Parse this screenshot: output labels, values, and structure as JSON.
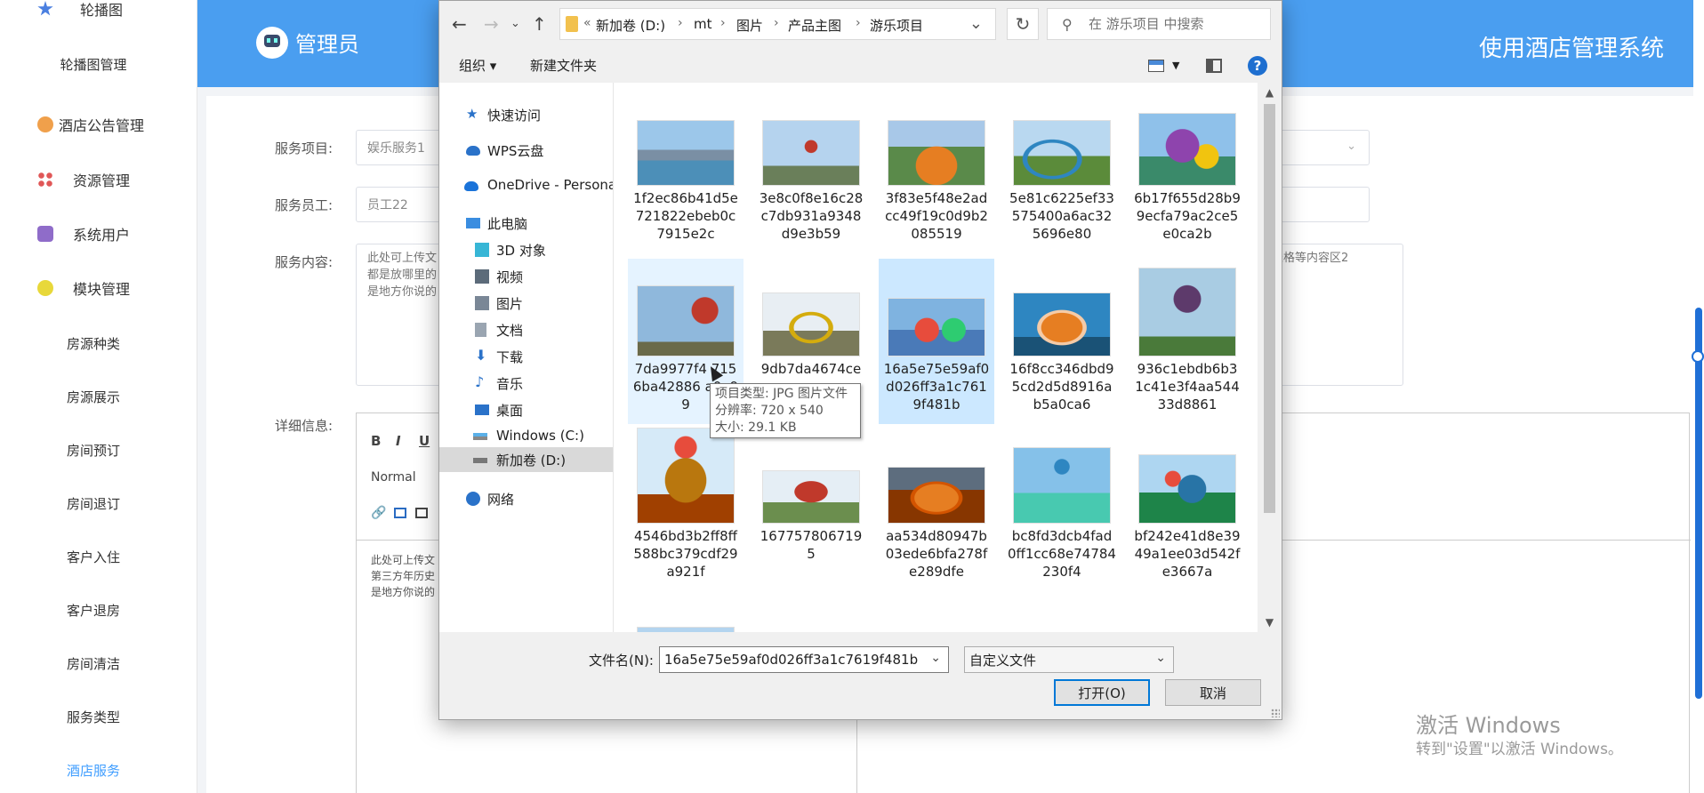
{
  "sidebar": {
    "items": [
      {
        "label": "轮播图",
        "icon": "star-icon"
      },
      {
        "label": "轮播图管理"
      },
      {
        "label": "酒店公告管理",
        "icon": "gear-icon"
      },
      {
        "label": "资源管理",
        "icon": "grid-icon"
      },
      {
        "label": "系统用户",
        "icon": "box-icon"
      },
      {
        "label": "模块管理",
        "icon": "cube-icon"
      },
      {
        "label": "房源种类"
      },
      {
        "label": "房源展示"
      },
      {
        "label": "房间预订"
      },
      {
        "label": "房间退订"
      },
      {
        "label": "客户入住"
      },
      {
        "label": "客户退房"
      },
      {
        "label": "房间清洁"
      },
      {
        "label": "服务类型"
      },
      {
        "label": "酒店服务"
      }
    ],
    "active_index": 14
  },
  "header": {
    "brand": "管理员",
    "system_title": "使用酒店管理系统"
  },
  "form": {
    "service_item_label": "服务项目:",
    "service_item_value": "娱乐服务1",
    "staff_label": "服务员工:",
    "staff_value": "员工22",
    "content_label": "服务内容:",
    "content_text_left": "此处可上传文\n都是放哪里的\n是地方你说的",
    "content_text_right": "、表格等内容区2",
    "detail_label": "详细信息:",
    "editor_bold": "B",
    "editor_italic": "I",
    "editor_underline": "U",
    "editor_format": "Normal",
    "editor_text": "此处可上传文\n第三方年历史\n是地方你说的"
  },
  "watermark": {
    "line1": "激活 Windows",
    "line2": "转到\"设置\"以激活 Windows。"
  },
  "dialog": {
    "address": [
      "新加卷 (D:)",
      "mt",
      "图片",
      "产品主图",
      "游乐项目"
    ],
    "address_prefix": "«",
    "search_placeholder": "在 游乐项目 中搜索",
    "organize": "组织 ▾",
    "new_folder": "新建文件夹",
    "help": "?",
    "nav": [
      {
        "label": "快速访问",
        "icon": "star-icon"
      },
      {
        "label": "WPS云盘",
        "icon": "cloud-icon"
      },
      {
        "label": "OneDrive - Persona",
        "icon": "onedrive-icon"
      },
      {
        "label": "此电脑",
        "icon": "computer-icon"
      },
      {
        "label": "3D 对象",
        "icon": "cube-3d-icon"
      },
      {
        "label": "视频",
        "icon": "video-icon"
      },
      {
        "label": "图片",
        "icon": "picture-icon"
      },
      {
        "label": "文档",
        "icon": "document-icon"
      },
      {
        "label": "下载",
        "icon": "download-icon"
      },
      {
        "label": "音乐",
        "icon": "music-icon"
      },
      {
        "label": "桌面",
        "icon": "desktop-icon"
      },
      {
        "label": "Windows (C:)",
        "icon": "drive-c-icon"
      },
      {
        "label": "新加卷 (D:)",
        "icon": "drive-d-icon"
      },
      {
        "label": "网络",
        "icon": "network-icon"
      }
    ],
    "nav_selected_index": 12,
    "files": [
      {
        "name": "1f2ec86b41d5e721822ebeb0c7915e2c"
      },
      {
        "name": "3e8c0f8e16c28c7db931a9348d9e3b59"
      },
      {
        "name": "3f83e5f48e2adcc49f19c0d9b2085519"
      },
      {
        "name": "5e81c6225ef33575400a6ac325696e80"
      },
      {
        "name": "6b17f655d28b99ecfa79ac2ce5e0ca2b"
      },
      {
        "name": "7da9977f4 7156ba42886 a0e99"
      },
      {
        "name": "9db7da4674ce a"
      },
      {
        "name": "16a5e75e59af0d026ff3a1c7619f481b"
      },
      {
        "name": "16f8cc346dbd95cd2d5d8916ab5a0ca6"
      },
      {
        "name": "936c1ebdb6b31c41e3f4aa54433d8861"
      },
      {
        "name": "4546bd3b2ff8ff588bc379cdf29a921f"
      },
      {
        "name": "1677578067195"
      },
      {
        "name": "aa534d80947b03ede6bfa278fe289dfe"
      },
      {
        "name": "bc8fd3dcb4fad0ff1cc68e74784230f4"
      },
      {
        "name": "bf242e41d8e3949a1ee03d542fe3667a"
      }
    ],
    "selected_file_index": 7,
    "hover_file_index": 5,
    "tooltip": {
      "type": "项目类型: JPG 图片文件",
      "resolution": "分辨率: 720 x 540",
      "size": "大小: 29.1 KB"
    },
    "filename_label": "文件名(N):",
    "filename_value": "16a5e75e59af0d026ff3a1c7619f481b",
    "filter_value": "自定义文件",
    "open_button": "打开(O)",
    "cancel_button": "取消",
    "colors": {
      "selected_bg": "#cce8ff",
      "hover_bg": "#e5f3ff",
      "accent": "#0078d7",
      "header_blue": "#4a9ef0"
    }
  }
}
